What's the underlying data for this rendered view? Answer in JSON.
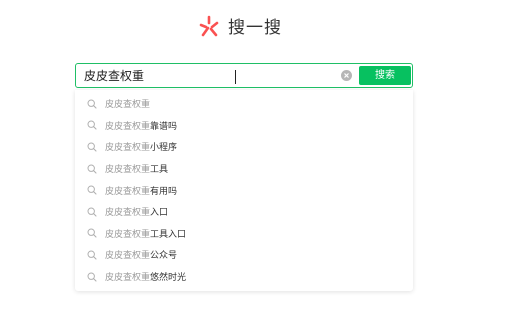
{
  "logo": {
    "text": "搜一搜",
    "icon": "sousou-logo-icon",
    "color": "#fa5151"
  },
  "search": {
    "value": "皮皮查权重",
    "button_label": "搜索",
    "accent": "#07c160"
  },
  "suggestions": [
    {
      "prefix": "皮皮查权重",
      "suffix": ""
    },
    {
      "prefix": "皮皮查权重",
      "suffix": "靠谱吗"
    },
    {
      "prefix": "皮皮查权重",
      "suffix": "小程序"
    },
    {
      "prefix": "皮皮查权重",
      "suffix": "工具"
    },
    {
      "prefix": "皮皮查权重",
      "suffix": "有用吗"
    },
    {
      "prefix": "皮皮查权重",
      "suffix": "入口"
    },
    {
      "prefix": "皮皮查权重",
      "suffix": "工具入口"
    },
    {
      "prefix": "皮皮查权重",
      "suffix": "公众号"
    },
    {
      "prefix": "皮皮查权重",
      "suffix": "悠然时光"
    }
  ]
}
